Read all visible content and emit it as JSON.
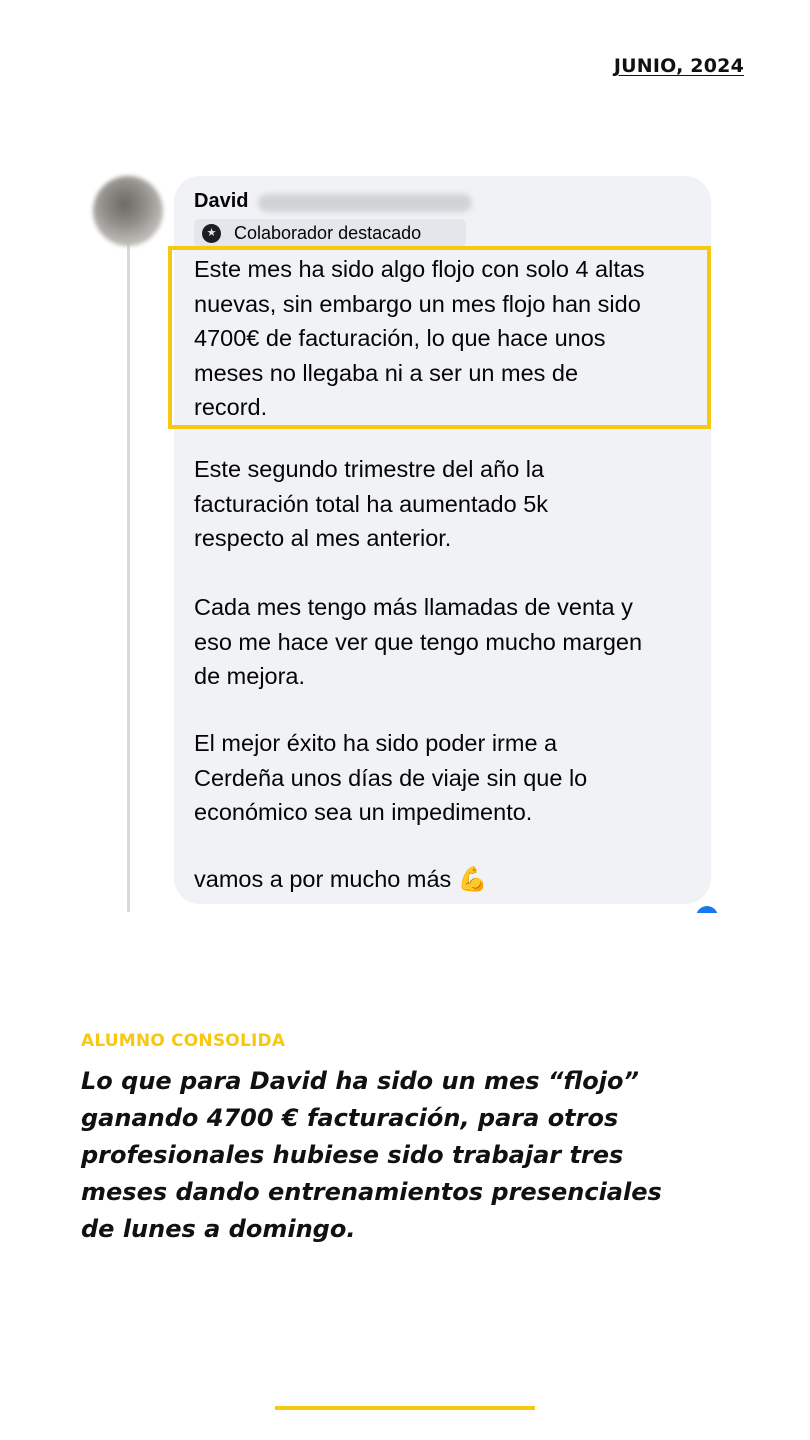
{
  "header": {
    "date": "JUNIO, 2024"
  },
  "comment": {
    "author": "David",
    "badge_icon": "star-badge-icon",
    "badge_label": "Colaborador destacado",
    "paragraphs": [
      "Este mes ha sido algo flojo con solo 4 altas\nnuevas, sin embargo un mes flojo han sido\n4700€ de facturación, lo que hace unos\nmeses no llegaba ni a ser un mes de\nrecord.",
      "Este segundo trimestre del año la\nfacturación total ha aumentado 5k\nrespecto al mes anterior.",
      "Cada mes tengo más llamadas de venta y\neso me hace ver que tengo mucho margen\nde mejora.",
      "El mejor éxito ha sido poder irme a\nCerdeña unos días de viaje sin que lo\neconómico sea un impedimento.",
      "vamos a por mucho más"
    ],
    "emoji": "💪",
    "highlight_color": "#f7c812"
  },
  "section": {
    "label": "ALUMNO CONSOLIDA",
    "caption": "Lo que para David ha sido un mes “flojo”\nganando 4700 € facturación, para otros\nprofesionales hubiese sido trabajar tres\nmeses dando entrenamientos presenciales\nde lunes a domingo."
  },
  "colors": {
    "accent": "#f7c812",
    "bubble": "#f0f2f5",
    "badge_bg": "#e4e6eb"
  }
}
